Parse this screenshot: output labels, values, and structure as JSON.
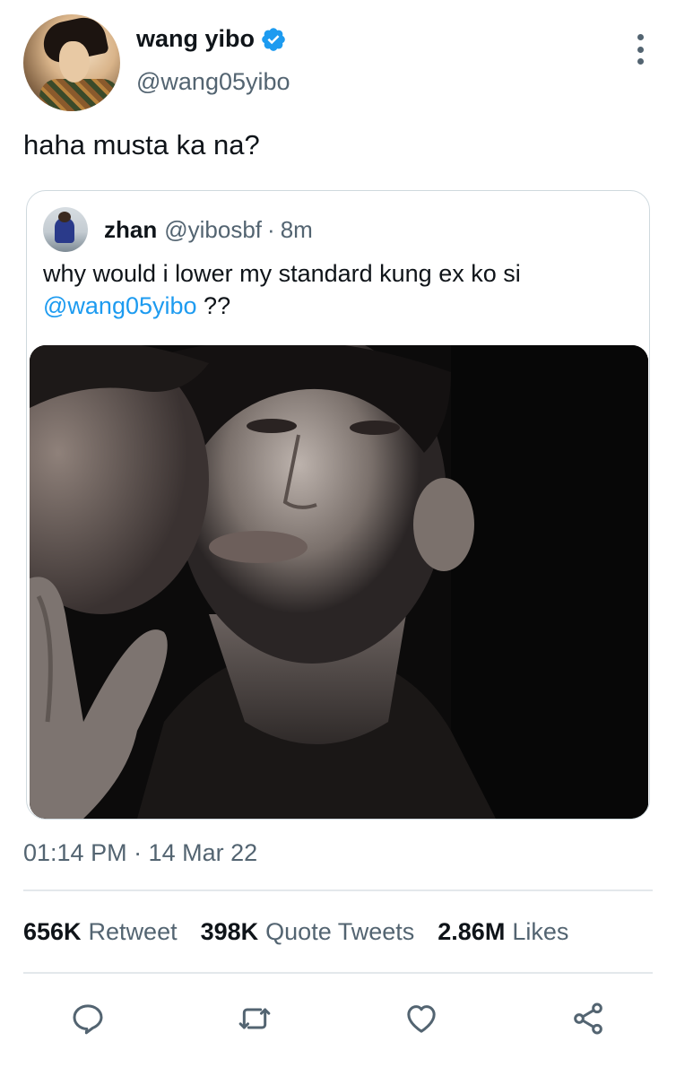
{
  "tweet": {
    "author": {
      "display_name": "wang yibo",
      "handle": "@wang05yibo",
      "verified_icon": "verified-badge-icon",
      "verified_color": "#1d9bf0"
    },
    "text": "haha musta ka na?",
    "quoted": {
      "display_name": "zhan",
      "handle": "@yibosbf",
      "separator": "·",
      "time": "8m",
      "text_before": "why would i lower my standard kung ex ko si",
      "mention": "@wang05yibo",
      "text_after": "??"
    },
    "timestamp": "01:14 PM · 14 Mar 22",
    "stats": {
      "retweets_count": "656K",
      "retweets_label": "Retweet",
      "quotes_count": "398K",
      "quotes_label": "Quote Tweets",
      "likes_count": "2.86M",
      "likes_label": "Likes"
    },
    "actions": [
      "reply-icon",
      "retweet-icon",
      "like-icon",
      "share-icon"
    ]
  },
  "colors": {
    "text_primary": "#0f1419",
    "text_secondary": "#536471",
    "accent": "#1d9bf0",
    "border": "#cfd9de"
  }
}
